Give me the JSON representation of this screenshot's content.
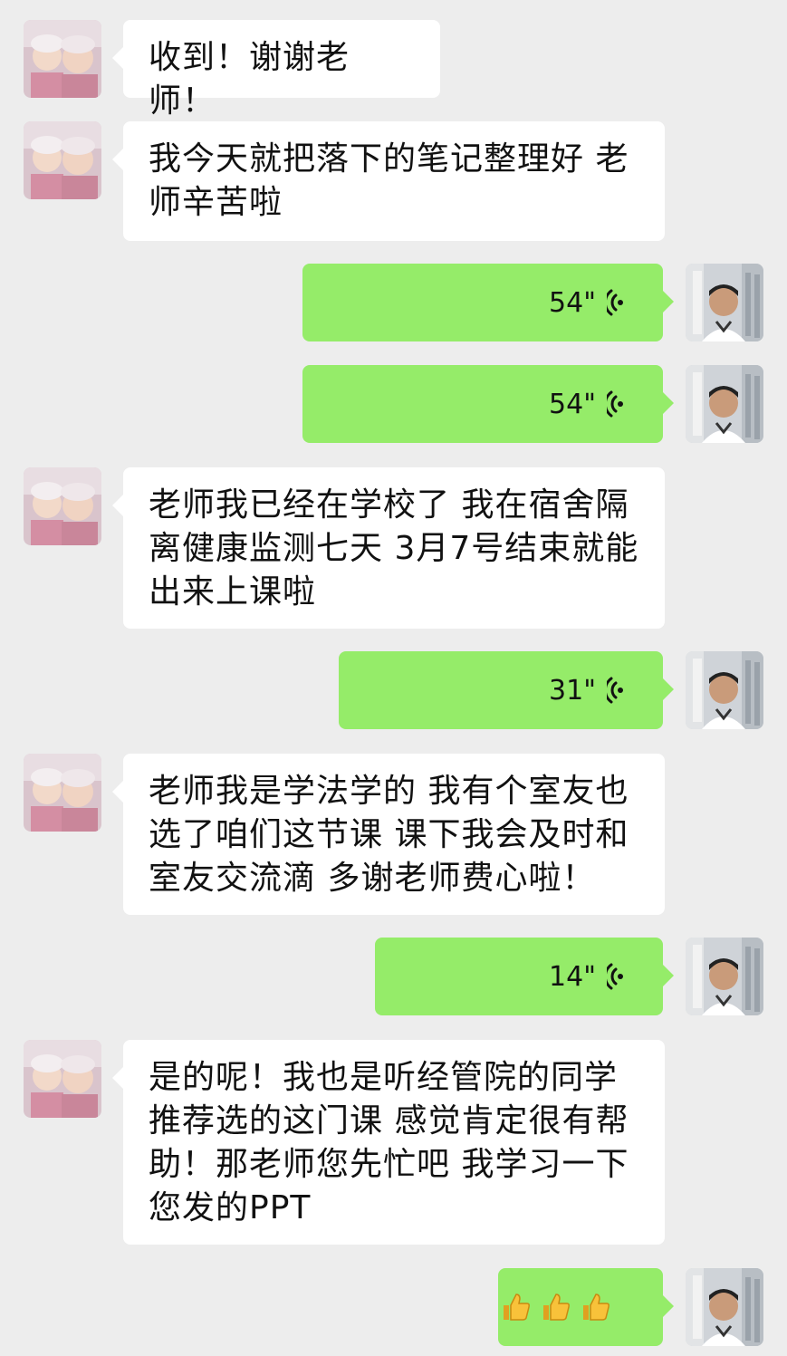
{
  "messages": [
    {
      "id": 1,
      "side": "in",
      "text": "收到！谢谢老师！"
    },
    {
      "id": 2,
      "side": "in",
      "text": "我今天就把落下的笔记整理好 老师辛苦啦"
    },
    {
      "id": 3,
      "side": "out",
      "type": "voice",
      "duration": "54\""
    },
    {
      "id": 4,
      "side": "out",
      "type": "voice",
      "duration": "54\""
    },
    {
      "id": 5,
      "side": "in",
      "text": "老师我已经在学校了 我在宿舍隔离健康监测七天 3月7号结束就能出来上课啦"
    },
    {
      "id": 6,
      "side": "out",
      "type": "voice",
      "duration": "31\""
    },
    {
      "id": 7,
      "side": "in",
      "text": "老师我是学法学的 我有个室友也选了咱们这节课 课下我会及时和室友交流滴 多谢老师费心啦！"
    },
    {
      "id": 8,
      "side": "out",
      "type": "voice",
      "duration": "14\""
    },
    {
      "id": 9,
      "side": "in",
      "text": "是的呢！我也是听经管院的同学推荐选的这门课 感觉肯定很有帮助！那老师您先忙吧 我学习一下您发的PPT"
    },
    {
      "id": 10,
      "side": "out",
      "type": "emoji",
      "emoji": "thumbs-up-icon"
    }
  ],
  "colors": {
    "background": "#ededed",
    "incoming_bubble": "#ffffff",
    "outgoing_bubble": "#95ec69",
    "text": "#111111"
  }
}
